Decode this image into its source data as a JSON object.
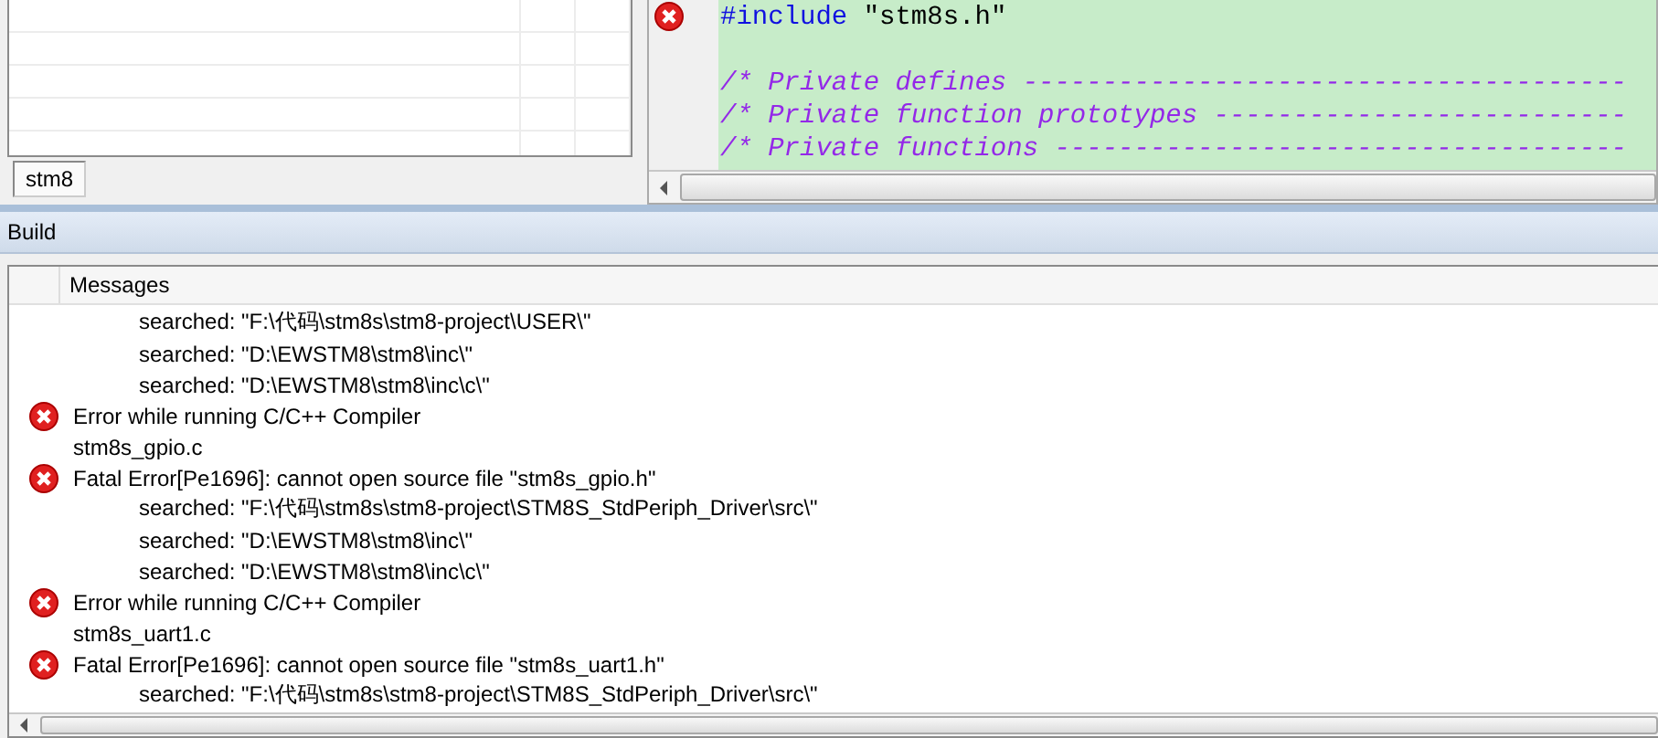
{
  "workspace": {
    "tabs": [
      {
        "label": "stm8",
        "selected": true
      }
    ]
  },
  "editor": {
    "lines": [
      {
        "kind": "directive",
        "keyword": "#include",
        "text": " \"stm8s.h\"",
        "error": true
      },
      {
        "kind": "blank",
        "error": false
      },
      {
        "kind": "comment",
        "text": "/* Private defines --------------------------------------",
        "error": false
      },
      {
        "kind": "comment",
        "text": "/* Private function prototypes --------------------------",
        "error": false
      },
      {
        "kind": "comment",
        "text": "/* Private functions ------------------------------------",
        "error": false
      }
    ]
  },
  "build": {
    "title": "Build",
    "columns": [
      "Messages"
    ],
    "messages": [
      {
        "kind": "detail",
        "text": "searched: \"F:\\代码\\stm8s\\stm8-project\\USER\\\""
      },
      {
        "kind": "detail",
        "text": "searched: \"D:\\EWSTM8\\stm8\\inc\\\""
      },
      {
        "kind": "detail",
        "text": "searched: \"D:\\EWSTM8\\stm8\\inc\\c\\\""
      },
      {
        "kind": "error",
        "text": "Error while running C/C++ Compiler"
      },
      {
        "kind": "text",
        "text": "stm8s_gpio.c"
      },
      {
        "kind": "error",
        "text": "Fatal Error[Pe1696]: cannot open source file \"stm8s_gpio.h\""
      },
      {
        "kind": "detail",
        "text": "searched: \"F:\\代码\\stm8s\\stm8-project\\STM8S_StdPeriph_Driver\\src\\\""
      },
      {
        "kind": "detail",
        "text": "searched: \"D:\\EWSTM8\\stm8\\inc\\\""
      },
      {
        "kind": "detail",
        "text": "searched: \"D:\\EWSTM8\\stm8\\inc\\c\\\""
      },
      {
        "kind": "error",
        "text": "Error while running C/C++ Compiler"
      },
      {
        "kind": "text",
        "text": "stm8s_uart1.c"
      },
      {
        "kind": "error",
        "text": "Fatal Error[Pe1696]: cannot open source file \"stm8s_uart1.h\""
      },
      {
        "kind": "detail",
        "text": "searched: \"F:\\代码\\stm8s\\stm8-project\\STM8S_StdPeriph_Driver\\src\\\""
      }
    ]
  }
}
